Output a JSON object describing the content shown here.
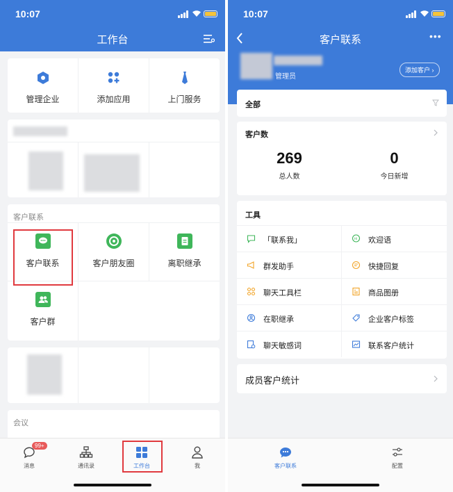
{
  "status_time": "10:07",
  "left": {
    "title": "工作台",
    "quick": [
      {
        "label": "管理企业"
      },
      {
        "label": "添加应用"
      },
      {
        "label": "上门服务"
      }
    ],
    "section_customer": "客户联系",
    "apps": [
      {
        "label": "客户联系"
      },
      {
        "label": "客户朋友圈"
      },
      {
        "label": "离职继承"
      },
      {
        "label": "客户群"
      }
    ],
    "section_meeting": "会议",
    "tabs": [
      {
        "label": "消息",
        "badge": "99+"
      },
      {
        "label": "通讯录"
      },
      {
        "label": "工作台"
      },
      {
        "label": "我"
      }
    ]
  },
  "right": {
    "title": "客户联系",
    "more": "•••",
    "role": "管理员",
    "add_customer": "添加客户 ›",
    "filter": "全部",
    "count_title": "客户数",
    "total_value": "269",
    "total_label": "总人数",
    "new_value": "0",
    "new_label": "今日新增",
    "tools_title": "工具",
    "tools": [
      {
        "label": "「联系我」"
      },
      {
        "label": "欢迎语"
      },
      {
        "label": "群发助手"
      },
      {
        "label": "快捷回复"
      },
      {
        "label": "聊天工具栏"
      },
      {
        "label": "商品图册"
      },
      {
        "label": "在职继承"
      },
      {
        "label": "企业客户标签"
      },
      {
        "label": "聊天敏感词"
      },
      {
        "label": "联系客户统计"
      }
    ],
    "member_stats": "成员客户统计",
    "tabs": [
      {
        "label": "客户联系"
      },
      {
        "label": "配置"
      }
    ]
  },
  "colors": {
    "header_blue": "#3d7bd9",
    "app_green": "#3fb65a",
    "highlight_red": "#e0393e",
    "active_tab": "#3d7bd9"
  }
}
